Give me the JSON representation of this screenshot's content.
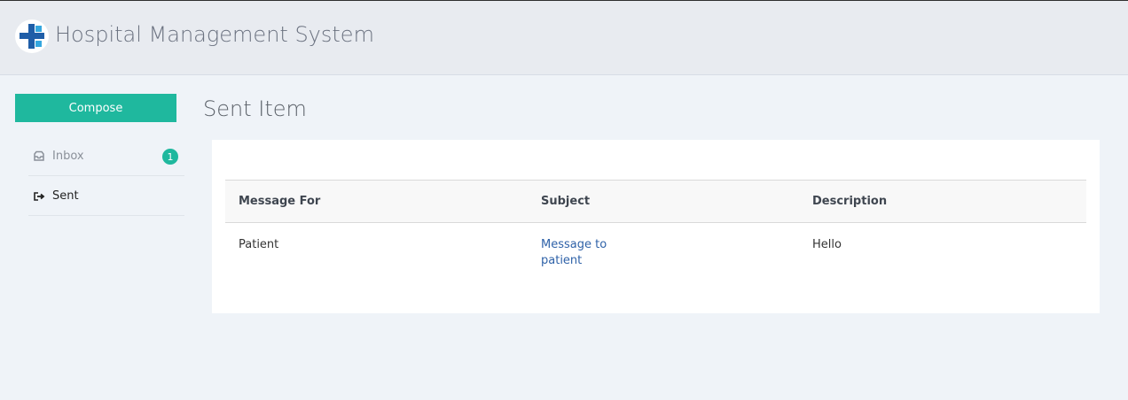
{
  "app": {
    "title": "Hospital Management System"
  },
  "sidebar": {
    "compose_label": "Compose",
    "items": [
      {
        "label": "Inbox",
        "badge": "1"
      },
      {
        "label": "Sent"
      }
    ]
  },
  "main": {
    "title": "Sent Item",
    "table": {
      "columns": [
        "Message For",
        "Subject",
        "Description"
      ],
      "rows": [
        [
          "Patient",
          "Message to patient",
          "Hello"
        ]
      ]
    }
  },
  "colors": {
    "accent": "#1fb89e",
    "link": "#2f62a8",
    "background": "#eff3f8"
  },
  "icons": {
    "logo": "medical-cross-logo-icon",
    "inbox": "inbox-tray-icon",
    "sent": "sign-out-arrow-icon"
  }
}
